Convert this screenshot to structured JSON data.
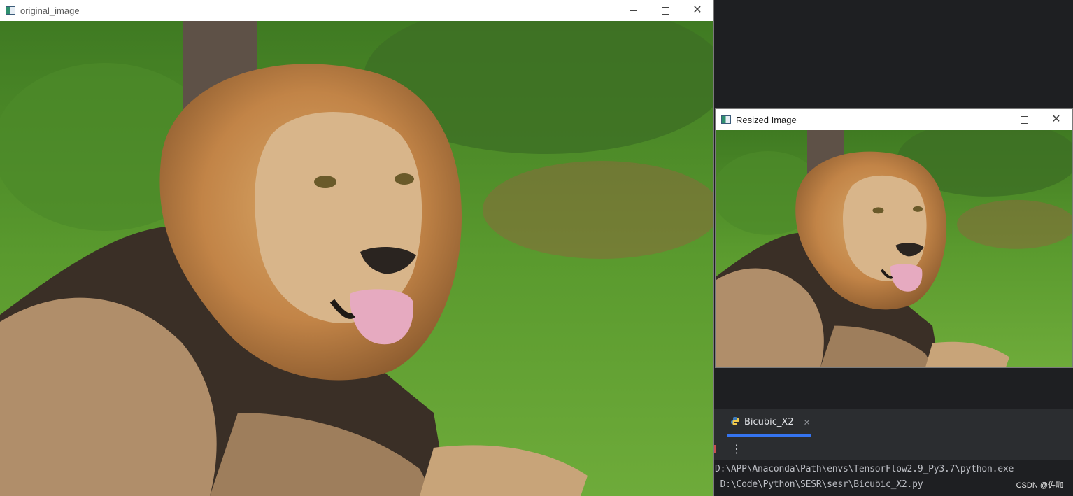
{
  "original_window": {
    "title": "original_image"
  },
  "resized_window": {
    "title": "Resized Image"
  },
  "run_panel": {
    "tab_label": "Bicubic_X2",
    "tab_icon": "python-icon",
    "console_lines": [
      "D:\\APP\\Anaconda\\Path\\envs\\TensorFlow2.9_Py3.7\\python.exe",
      " D:\\Code\\Python\\SESR\\sesr\\Bicubic_X2.py"
    ]
  },
  "watermark": "CSDN @佐咖",
  "colors": {
    "ide_bg": "#1e1f22",
    "accent": "#3574f0",
    "grass": "#4f8a2a",
    "mane": "#c98c4a"
  }
}
